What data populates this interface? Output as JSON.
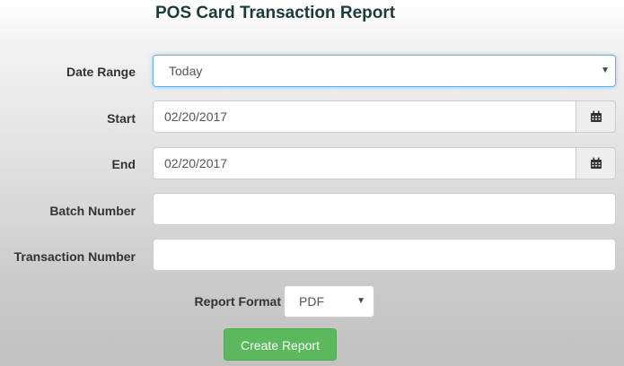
{
  "title": "POS Card Transaction Report",
  "form": {
    "date_range": {
      "label": "Date Range",
      "value": "Today"
    },
    "start": {
      "label": "Start",
      "value": "02/20/2017"
    },
    "end": {
      "label": "End",
      "value": "02/20/2017"
    },
    "batch_number": {
      "label": "Batch Number",
      "value": ""
    },
    "transaction_number": {
      "label": "Transaction Number",
      "value": ""
    },
    "report_format": {
      "label": "Report Format",
      "value": "PDF"
    },
    "submit_label": "Create Report"
  },
  "icons": {
    "dropdown": "caret-down-icon",
    "date_picker": "calendar-icon"
  },
  "colors": {
    "title": "#1b3b39",
    "button": "#5cb85c",
    "focus_border": "#66afe9"
  }
}
